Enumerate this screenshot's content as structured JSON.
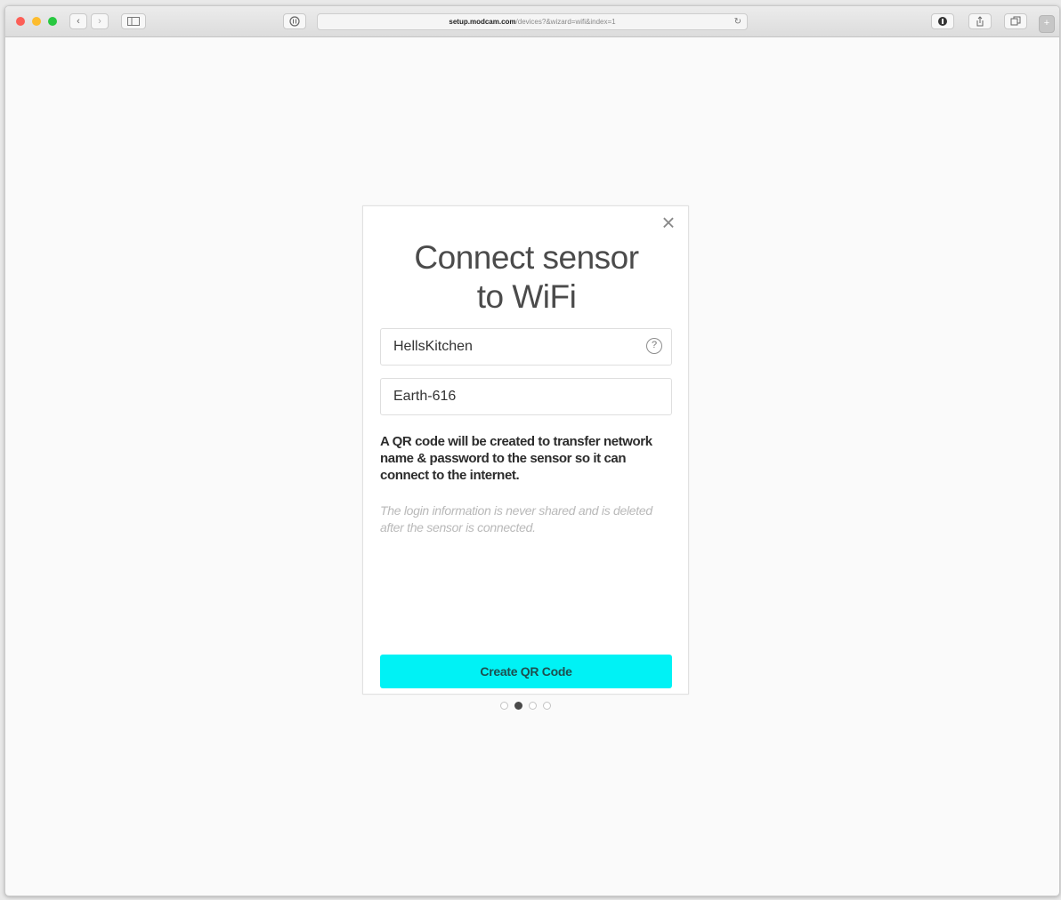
{
  "browser": {
    "url_host": "setup.modcam.com",
    "url_path": "/devices?&wizard=wifi&index=1",
    "reader_icon": "reader-icon",
    "reload_icon": "reload-icon"
  },
  "dialog": {
    "title_line1": "Connect sensor",
    "title_line2": "to WiFi",
    "close_glyph": "×",
    "network_field": {
      "value": "HellsKitchen"
    },
    "help_glyph": "?",
    "password_field": {
      "value": "Earth-616"
    },
    "info_text": "A QR code will be created to transfer network name & password to the sensor so it can connect to the internet.",
    "privacy_note": "The login information is never shared and is deleted after the sensor is connected.",
    "cta_label": "Create QR Code"
  },
  "wizard": {
    "total_steps": 4,
    "current_step": 2
  },
  "colors": {
    "accent": "#00f2f5",
    "title": "#4b4b4b",
    "note": "#b9b9b9"
  }
}
